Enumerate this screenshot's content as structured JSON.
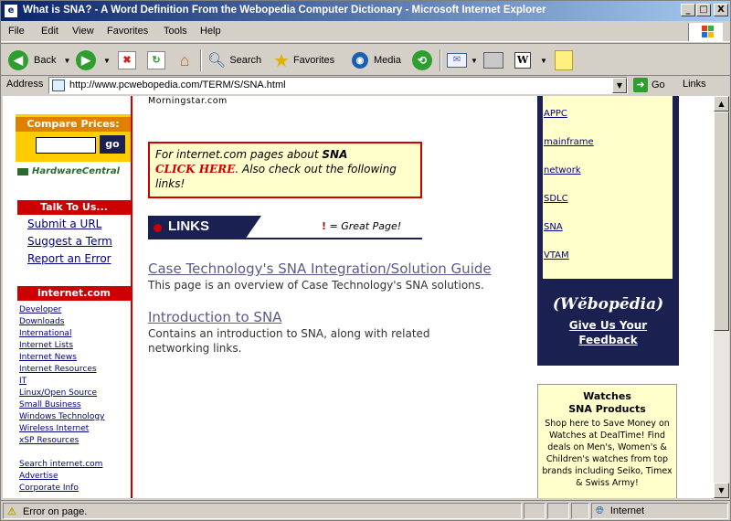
{
  "window": {
    "title": "What is SNA? - A Word Definition From the Webopedia Computer Dictionary - Microsoft Internet Explorer",
    "controls": {
      "minimize": "_",
      "maximize": "□",
      "close": "X"
    }
  },
  "menubar": {
    "items": [
      "File",
      "Edit",
      "View",
      "Favorites",
      "Tools",
      "Help"
    ]
  },
  "toolbar": {
    "back_label": "Back",
    "search_label": "Search",
    "favorites_label": "Favorites",
    "media_label": "Media"
  },
  "address": {
    "label": "Address",
    "url": "http://www.pcwebopedia.com/TERM/S/SNA.html",
    "go_label": "Go",
    "links_label": "Links"
  },
  "left": {
    "compare_heading": "Compare Prices:",
    "compare_go": "go",
    "hardware_label": "HardwareCentral",
    "talk_heading": "Talk To Us...",
    "talk_links": [
      "Submit a URL",
      "Suggest a Term",
      "Report an Error"
    ],
    "internet_heading": "internet.com",
    "internet_links": [
      "Developer",
      "Downloads",
      "International",
      "Internet Lists",
      "Internet News",
      "Internet Resources",
      "IT",
      "Linux/Open Source",
      "Small Business",
      "Windows Technology",
      "Wireless Internet",
      "xSP Resources"
    ],
    "internet_links2": [
      "Search internet.com",
      "Advertise",
      "Corporate Info"
    ]
  },
  "center": {
    "top_text": "Morningstar.com",
    "promo_prefix": "For internet.com pages about ",
    "promo_term": "SNA",
    "promo_link": "CLICK HERE",
    "promo_suffix": ". Also check out the following links!",
    "links_banner": "LINKS",
    "great_page_mark": "!",
    "great_page": "= Great Page!",
    "results": [
      {
        "title": "Case Technology's SNA Integration/Solution Guide",
        "desc": "This page is an overview of Case Technology's SNA solutions."
      },
      {
        "title": "Introduction to SNA",
        "desc": "Contains an introduction to SNA, along with related networking links."
      }
    ]
  },
  "right": {
    "related_terms": [
      "APPC",
      "mainframe",
      "network",
      "SDLC",
      "SNA",
      "VTAM"
    ],
    "webopedia": "(Wĕbopēdia)",
    "feedback_line1": "Give Us Your",
    "feedback_line2": "Feedback",
    "ad_title1": "Watches",
    "ad_title2": "SNA Products",
    "ad_body": "Shop here to Save Money on Watches at DealTime! Find deals on Men's, Women's & Children's watches from top brands including Seiko, Timex & Swiss Army!"
  },
  "status": {
    "text": "Error on page.",
    "zone": "Internet"
  }
}
